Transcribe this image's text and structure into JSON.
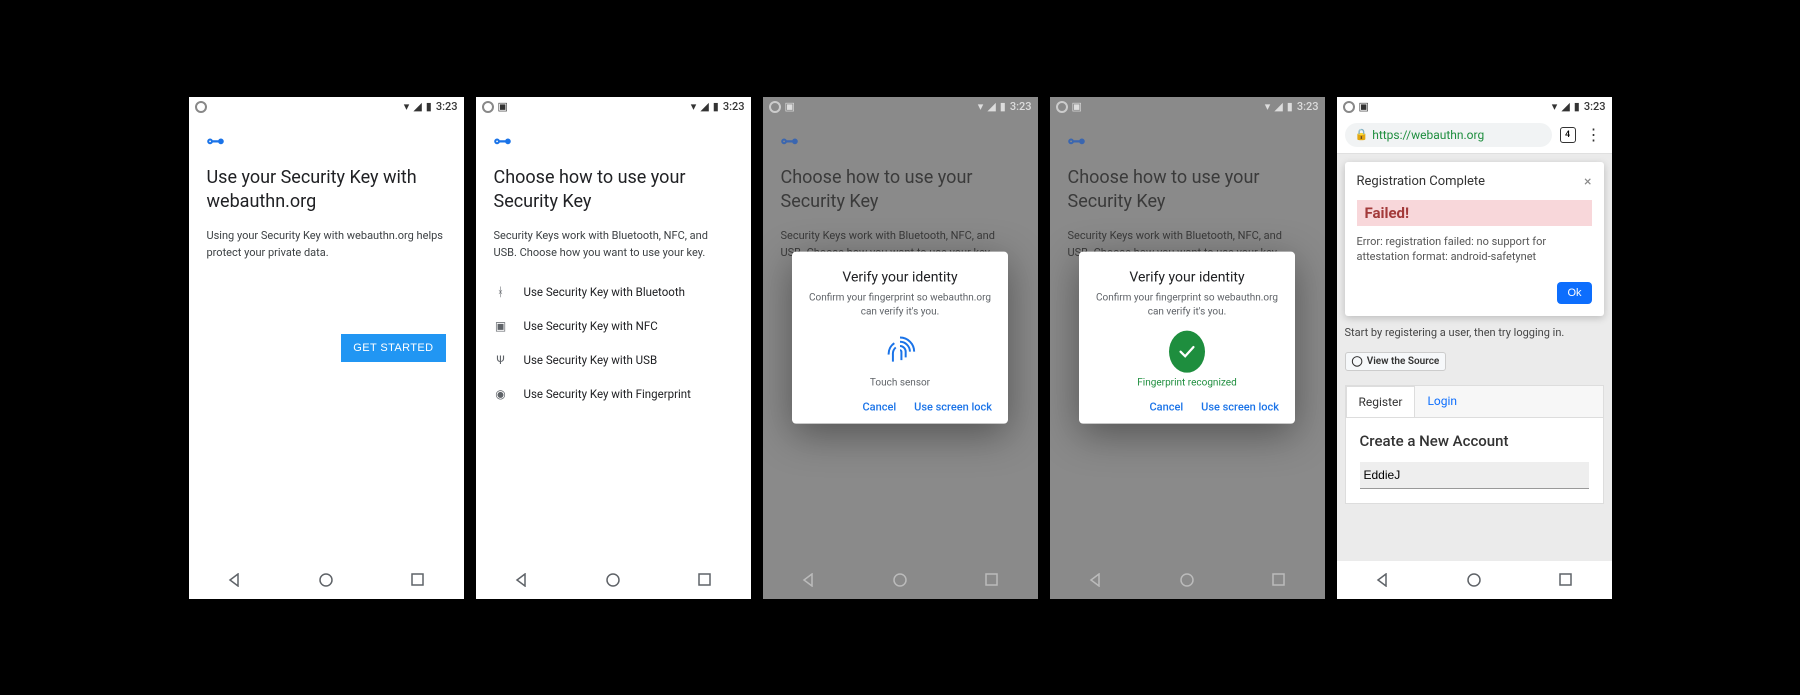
{
  "status": {
    "time": "3:23"
  },
  "screen1": {
    "title": "Use your Security Key with webauthn.org",
    "subtitle": "Using your Security Key with webauthn.org helps protect your private data.",
    "cta": "GET STARTED"
  },
  "screen2": {
    "title": "Choose how to use your Security Key",
    "subtitle": "Security Keys work with Bluetooth, NFC, and USB. Choose how you want to use your key.",
    "options": [
      {
        "label": "Use Security Key with Bluetooth"
      },
      {
        "label": "Use Security Key with NFC"
      },
      {
        "label": "Use Security Key with USB"
      },
      {
        "label": "Use Security Key with Fingerprint"
      }
    ]
  },
  "dialog": {
    "title": "Verify your identity",
    "subtitle": "Confirm your fingerprint so webauthn.org can verify it's you.",
    "touch": "Touch sensor",
    "recognized": "Fingerprint recognized",
    "cancel": "Cancel",
    "use_lock": "Use screen lock"
  },
  "screen5": {
    "url": "https://webauthn.org",
    "tabs": "4",
    "card_title": "Registration Complete",
    "alert": "Failed!",
    "error": "Error: registration failed: no support for attestation format: android-safetynet",
    "ok": "Ok",
    "hint": "Start by registering a user, then try logging in.",
    "view_source": "View the Source",
    "tab_register": "Register",
    "tab_login": "Login",
    "form_title": "Create a New Account",
    "username": "EddieJ"
  }
}
